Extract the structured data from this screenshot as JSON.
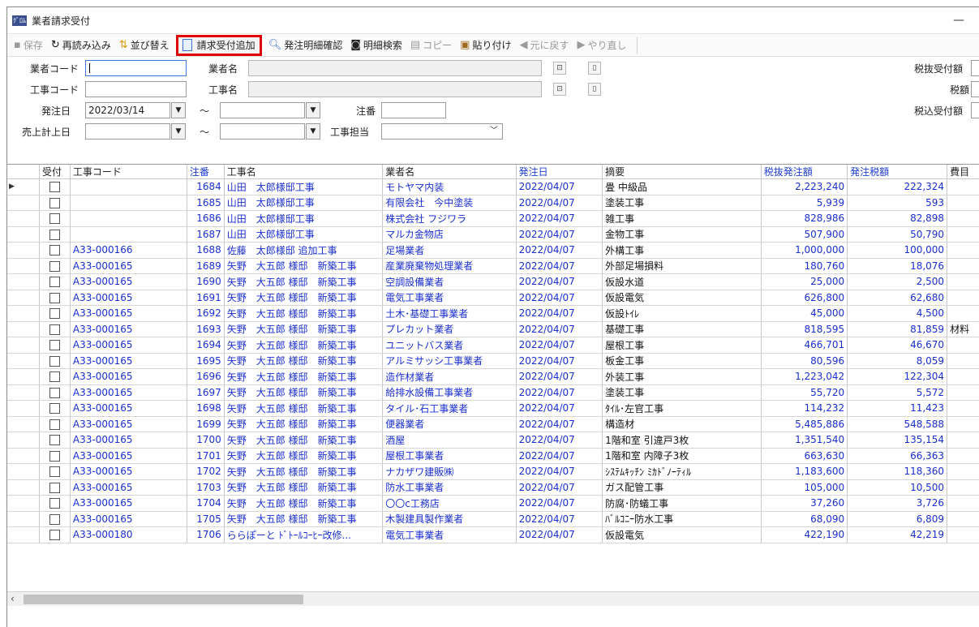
{
  "window": {
    "title": "業者請求受付",
    "app_icon": "ｸﾞﾛﾑ",
    "minimize": "—"
  },
  "toolbar": {
    "save": "保存",
    "reload": "再読み込み",
    "sort": "並び替え",
    "add_invoice": "請求受付追加",
    "order_detail_confirm": "発注明細確認",
    "detail_search": "明細検索",
    "copy": "コピー",
    "paste": "貼り付け",
    "undo": "元に戻す",
    "redo": "やり直し"
  },
  "form": {
    "vendor_code_label": "業者コード",
    "vendor_name_label": "業者名",
    "construction_code_label": "工事コード",
    "construction_name_label": "工事名",
    "order_date_label": "発注日",
    "order_date_from": "2022/03/14",
    "tilde": "～",
    "order_no_label": "注番",
    "sales_date_label": "売上計上日",
    "construction_staff_label": "工事担当",
    "pre_tax_received_label": "税抜受付額",
    "tax_label": "税額",
    "tax_incl_received_label": "税込受付額"
  },
  "grid": {
    "columns": [
      "受付",
      "工事コード",
      "注番",
      "工事名",
      "業者名",
      "発注日",
      "摘要",
      "税抜発注額",
      "発注税額",
      "費目"
    ],
    "rows": [
      {
        "code": "",
        "no": "1684",
        "cname": "山田　太郎様邸工事",
        "vendor": "モトヤマ内装",
        "date": "2022/04/07",
        "memo": "畳 中級品",
        "amount": "2,223,240",
        "tax": "222,324",
        "cat": ""
      },
      {
        "code": "",
        "no": "1685",
        "cname": "山田　太郎様邸工事",
        "vendor": "有限会社　今中塗装",
        "date": "2022/04/07",
        "memo": "塗装工事",
        "amount": "5,939",
        "tax": "593",
        "cat": ""
      },
      {
        "code": "",
        "no": "1686",
        "cname": "山田　太郎様邸工事",
        "vendor": "株式会社 フジワラ",
        "date": "2022/04/07",
        "memo": "雑工事",
        "amount": "828,986",
        "tax": "82,898",
        "cat": ""
      },
      {
        "code": "",
        "no": "1687",
        "cname": "山田　太郎様邸工事",
        "vendor": "マルカ金物店",
        "date": "2022/04/07",
        "memo": "金物工事",
        "amount": "507,900",
        "tax": "50,790",
        "cat": ""
      },
      {
        "code": "A33-000166",
        "no": "1688",
        "cname": "佐藤　太郎様邸 追加工事",
        "vendor": "足場業者",
        "date": "2022/04/07",
        "memo": "外構工事",
        "amount": "1,000,000",
        "tax": "100,000",
        "cat": ""
      },
      {
        "code": "A33-000165",
        "no": "1689",
        "cname": "矢野　大五郎 様邸　新築工事",
        "vendor": "産業廃棄物処理業者",
        "date": "2022/04/07",
        "memo": "外部足場損料",
        "amount": "180,760",
        "tax": "18,076",
        "cat": ""
      },
      {
        "code": "A33-000165",
        "no": "1690",
        "cname": "矢野　大五郎 様邸　新築工事",
        "vendor": "空調設備業者",
        "date": "2022/04/07",
        "memo": "仮設水道",
        "amount": "25,000",
        "tax": "2,500",
        "cat": ""
      },
      {
        "code": "A33-000165",
        "no": "1691",
        "cname": "矢野　大五郎 様邸　新築工事",
        "vendor": "電気工事業者",
        "date": "2022/04/07",
        "memo": "仮設電気",
        "amount": "626,800",
        "tax": "62,680",
        "cat": ""
      },
      {
        "code": "A33-000165",
        "no": "1692",
        "cname": "矢野　大五郎 様邸　新築工事",
        "vendor": "土木･基礎工事業者",
        "date": "2022/04/07",
        "memo": "仮設ﾄｲﾚ",
        "amount": "45,000",
        "tax": "4,500",
        "cat": ""
      },
      {
        "code": "A33-000165",
        "no": "1693",
        "cname": "矢野　大五郎 様邸　新築工事",
        "vendor": "プレカット業者",
        "date": "2022/04/07",
        "memo": "基礎工事",
        "amount": "818,595",
        "tax": "81,859",
        "cat": "材料"
      },
      {
        "code": "A33-000165",
        "no": "1694",
        "cname": "矢野　大五郎 様邸　新築工事",
        "vendor": "ユニットバス業者",
        "date": "2022/04/07",
        "memo": "屋根工事",
        "amount": "466,701",
        "tax": "46,670",
        "cat": ""
      },
      {
        "code": "A33-000165",
        "no": "1695",
        "cname": "矢野　大五郎 様邸　新築工事",
        "vendor": "アルミサッシ工事業者",
        "date": "2022/04/07",
        "memo": "板金工事",
        "amount": "80,596",
        "tax": "8,059",
        "cat": ""
      },
      {
        "code": "A33-000165",
        "no": "1696",
        "cname": "矢野　大五郎 様邸　新築工事",
        "vendor": "造作材業者",
        "date": "2022/04/07",
        "memo": "外装工事",
        "amount": "1,223,042",
        "tax": "122,304",
        "cat": ""
      },
      {
        "code": "A33-000165",
        "no": "1697",
        "cname": "矢野　大五郎 様邸　新築工事",
        "vendor": "給排水設備工事業者",
        "date": "2022/04/07",
        "memo": "塗装工事",
        "amount": "55,720",
        "tax": "5,572",
        "cat": ""
      },
      {
        "code": "A33-000165",
        "no": "1698",
        "cname": "矢野　大五郎 様邸　新築工事",
        "vendor": "タイル･石工事業者",
        "date": "2022/04/07",
        "memo": "ﾀｲﾙ･左官工事",
        "amount": "114,232",
        "tax": "11,423",
        "cat": ""
      },
      {
        "code": "A33-000165",
        "no": "1699",
        "cname": "矢野　大五郎 様邸　新築工事",
        "vendor": "便器業者",
        "date": "2022/04/07",
        "memo": "構造材",
        "amount": "5,485,886",
        "tax": "548,588",
        "cat": ""
      },
      {
        "code": "A33-000165",
        "no": "1700",
        "cname": "矢野　大五郎 様邸　新築工事",
        "vendor": "酒屋",
        "date": "2022/04/07",
        "memo": "1階和室 引違戸3枚",
        "amount": "1,351,540",
        "tax": "135,154",
        "cat": ""
      },
      {
        "code": "A33-000165",
        "no": "1701",
        "cname": "矢野　大五郎 様邸　新築工事",
        "vendor": "屋根工事業者",
        "date": "2022/04/07",
        "memo": "1階和室 内障子3枚",
        "amount": "663,630",
        "tax": "66,363",
        "cat": ""
      },
      {
        "code": "A33-000165",
        "no": "1702",
        "cname": "矢野　大五郎 様邸　新築工事",
        "vendor": "ナカザワ建販㈱",
        "date": "2022/04/07",
        "memo": "ｼｽﾃﾑｷｯﾁﾝ ﾐｶﾄﾞﾉｰﾃｨﾙ",
        "amount": "1,183,600",
        "tax": "118,360",
        "cat": ""
      },
      {
        "code": "A33-000165",
        "no": "1703",
        "cname": "矢野　大五郎 様邸　新築工事",
        "vendor": "防水工事業者",
        "date": "2022/04/07",
        "memo": "ガス配管工事",
        "amount": "105,000",
        "tax": "10,500",
        "cat": ""
      },
      {
        "code": "A33-000165",
        "no": "1704",
        "cname": "矢野　大五郎 様邸　新築工事",
        "vendor": "〇〇c工務店",
        "date": "2022/04/07",
        "memo": "防腐･防蟻工事",
        "amount": "37,260",
        "tax": "3,726",
        "cat": ""
      },
      {
        "code": "A33-000165",
        "no": "1705",
        "cname": "矢野　大五郎 様邸　新築工事",
        "vendor": "木製建具製作業者",
        "date": "2022/04/07",
        "memo": "ﾊﾞﾙｺﾆｰ防水工事",
        "amount": "68,090",
        "tax": "6,809",
        "cat": ""
      },
      {
        "code": "A33-000180",
        "no": "1706",
        "cname": "ららぽーと ﾄﾞﾄｰﾙｺｰﾋｰ改修...",
        "vendor": "電気工事業者",
        "date": "2022/04/07",
        "memo": "仮設電気",
        "amount": "422,190",
        "tax": "42,219",
        "cat": ""
      }
    ]
  },
  "colors": {
    "link": "#1a2fd0",
    "highlight_border": "#e00000"
  }
}
